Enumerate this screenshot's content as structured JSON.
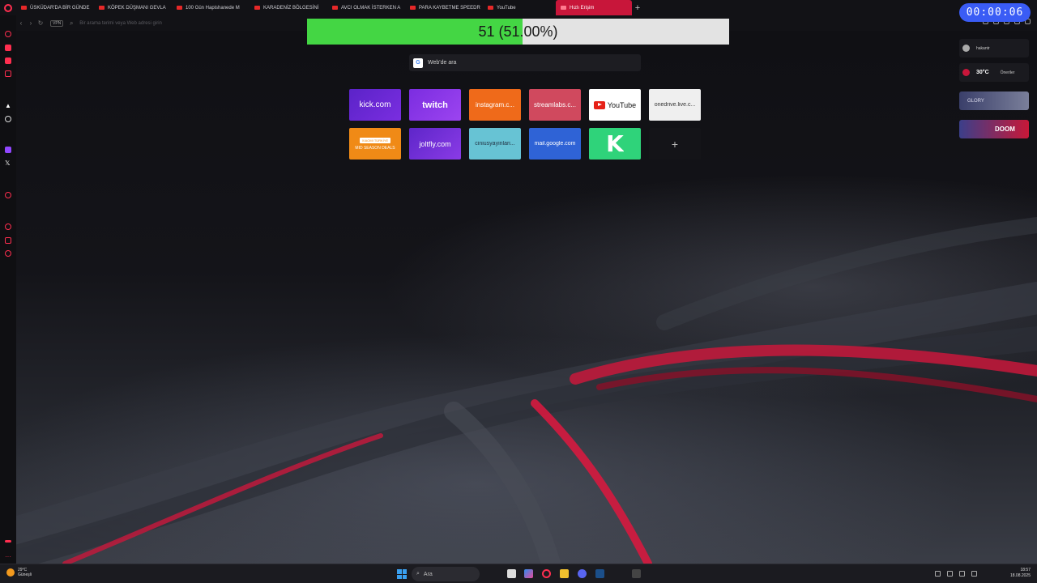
{
  "tabs": [
    {
      "label": "ÜSKÜDAR'DA BİR GÜNDE"
    },
    {
      "label": "KÖPEK DÜŞMANI GEVLA"
    },
    {
      "label": "100 Gün Hapishanede M"
    },
    {
      "label": "KARADENİZ BÖLGESİNİ"
    },
    {
      "label": "AVCI OLMAK İSTERKEN A"
    },
    {
      "label": "PARA KAYBETME SPEEDR"
    },
    {
      "label": "YouTube"
    },
    {
      "label": "Hızlı Erişim"
    }
  ],
  "address_bar": {
    "vpn": "VPN",
    "placeholder": "Bir arama terimi veya Web adresi girin"
  },
  "progress": {
    "value_fraction": 0.51,
    "label": "51 (51.00%)"
  },
  "timer": {
    "text": "00:00:06"
  },
  "search": {
    "label": "Web'de ara",
    "engine_glyph": "G"
  },
  "speed_dials": [
    {
      "label": "kick.com"
    },
    {
      "label": "twitch"
    },
    {
      "label": "instagram.c..."
    },
    {
      "label": "streamlabs.c..."
    },
    {
      "label": "YouTube"
    },
    {
      "label": "onedrive.live.c..."
    },
    {
      "label": "MID SEASON DEALS",
      "badge": "XIAOMI TÜRKİYE"
    },
    {
      "label": "joltfly.com"
    },
    {
      "label": "ciniusyayinlari..."
    },
    {
      "label": "mail.google.com"
    },
    {
      "label": "K"
    },
    {
      "label": "+"
    }
  ],
  "right_panel": {
    "items": [
      {
        "label": "hakantr"
      },
      {
        "label": "30°C",
        "sub": "Öneriler"
      },
      {
        "label": "GLORY"
      },
      {
        "label": "DOOM"
      }
    ]
  },
  "taskbar": {
    "weather_temp": "29°C",
    "weather_desc": "Güneşli",
    "search_label": "Ara",
    "time": "18:57",
    "date": "18.08.2025"
  },
  "colors": {
    "accent": "#ff2e4f",
    "progress_fill": "#44d644",
    "timer_bg": "#3a5cf5"
  }
}
